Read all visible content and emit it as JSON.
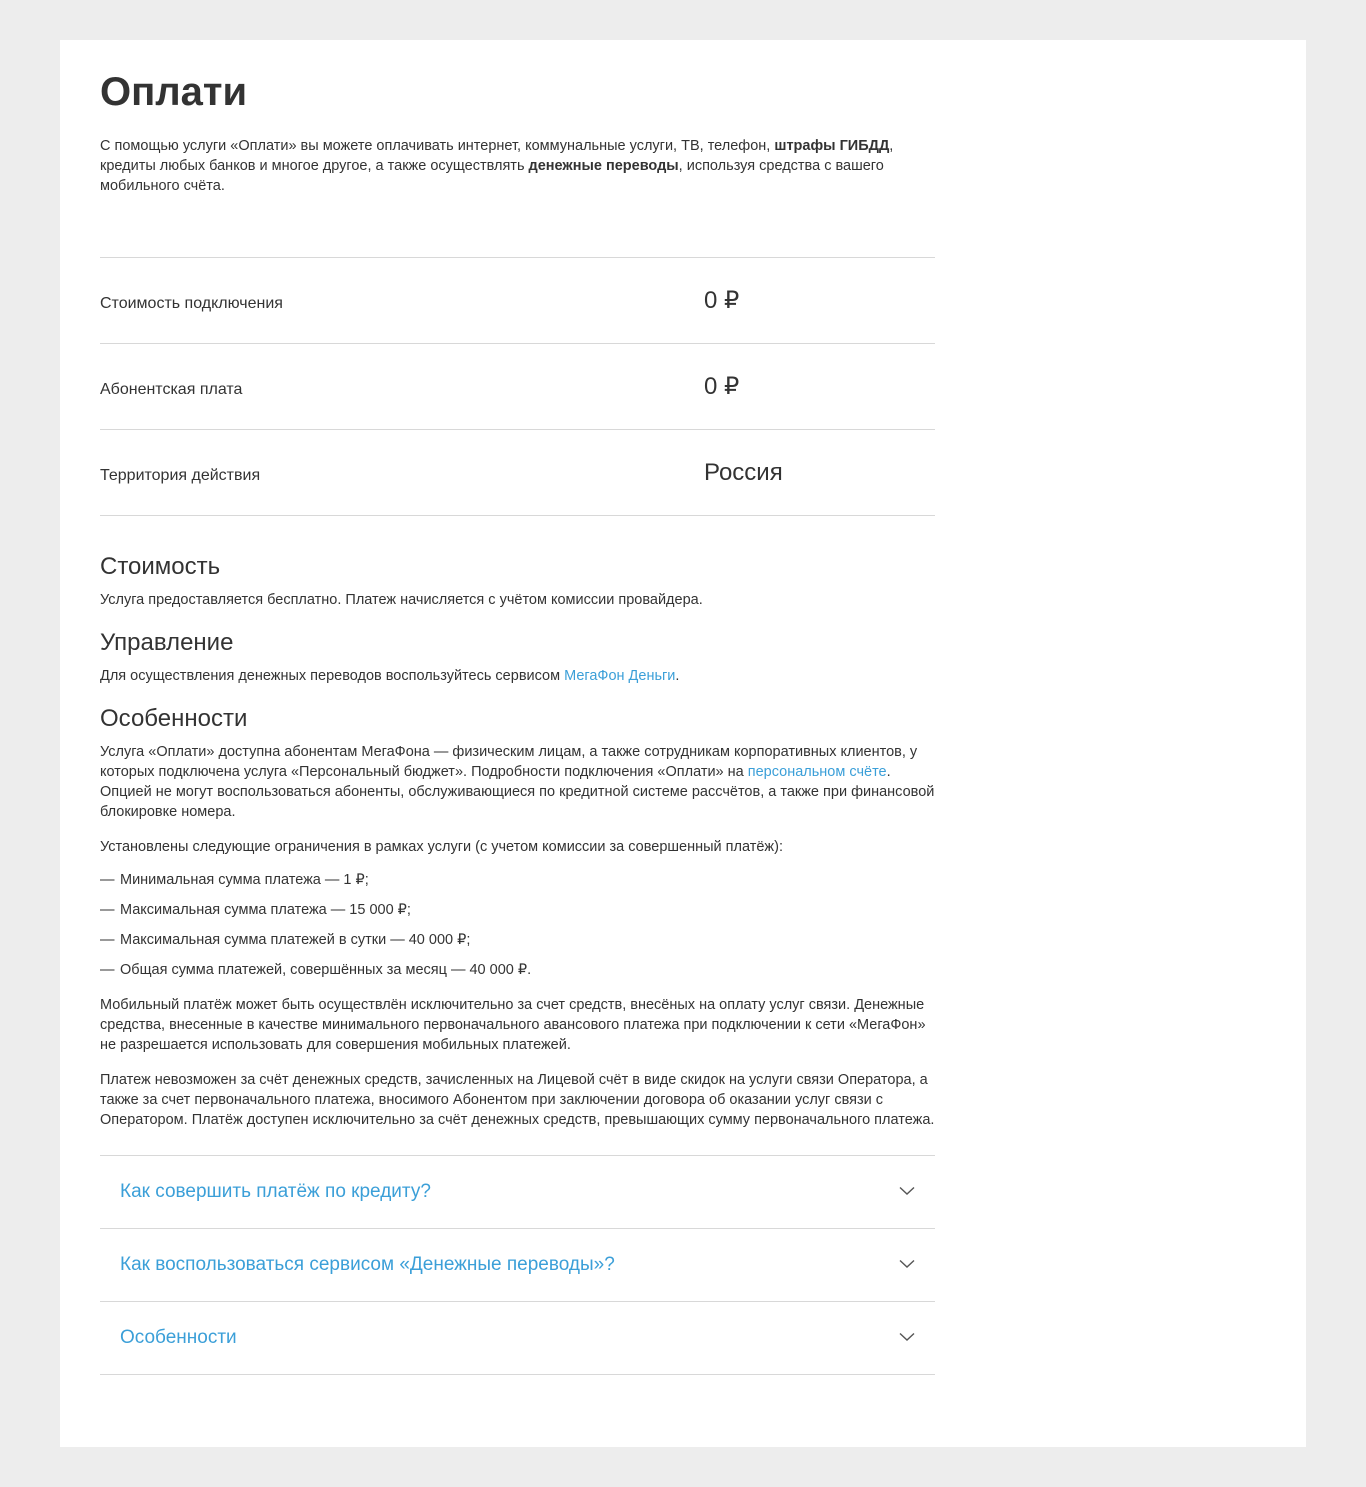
{
  "page": {
    "title": "Оплати",
    "intro": {
      "part1": "С помощью услуги «Оплати» вы можете оплачивать интернет, коммунальные услуги, ТВ, телефон, ",
      "bold1": "штрафы ГИБДД",
      "part2": ", кредиты любых банков и многое другое, а также осуществлять ",
      "bold2": "денежные переводы",
      "part3": ", используя средства с вашего мобильного счёта."
    }
  },
  "params": [
    {
      "label": "Стоимость подключения",
      "value": "0 ₽"
    },
    {
      "label": "Абонентская плата",
      "value": "0 ₽"
    },
    {
      "label": "Территория действия",
      "value": "Россия"
    }
  ],
  "cost": {
    "title": "Стоимость",
    "text": "Услуга предоставляется бесплатно. Платеж начисляется с учётом комиссии провайдера."
  },
  "management": {
    "title": "Управление",
    "text_before": "Для осуществления денежных переводов воспользуйтесь сервисом ",
    "link": "МегаФон Деньги",
    "text_after": "."
  },
  "features": {
    "title": "Особенности",
    "p1_before": "Услуга «Оплати» доступна абонентам МегаФона — физическим лицам, а также сотрудникам корпоративных клиентов, у которых подключена услуга «Персональный бюджет». Подробности подключения «Оплати» на ",
    "p1_link": "персональном счёте",
    "p1_after": ". Опцией не могут воспользоваться абоненты, обслуживающиеся по кредитной системе рассчётов, а также при финансовой блокировке номера.",
    "p2": "Установлены следующие ограничения в рамках услуги (с учетом комиссии за совершенный платёж):",
    "dash": "—",
    "limits": [
      "Минимальная сумма платежа — 1 ₽;",
      "Максимальная сумма платежа — 15 000 ₽;",
      "Максимальная сумма платежей в сутки — 40 000 ₽;",
      "Общая сумма платежей, совершённых за месяц — 40 000 ₽."
    ],
    "p3": "Мобильный платёж может быть осуществлён исключительно за счет средств, внесёных на оплату услуг связи. Денежные средства, внесенные в качестве минимального первоначального авансового платежа при подключении к сети «МегаФон» не разрешается использовать для совершения мобильных платежей.",
    "p4": "Платеж невозможен за счёт денежных средств, зачисленных на Лицевой счёт в виде скидок на услуги связи Оператора, а также за счет первоначального платежа, вносимого Абонентом при заключении договора об оказании услуг связи с Оператором. Платёж доступен исключительно за счёт денежных средств, превышающих сумму первоначального платежа."
  },
  "faq": [
    {
      "title": "Как совершить платёж по кредиту?",
      "icon": "chevron-down-icon"
    },
    {
      "title": "Как воспользоваться сервисом «Денежные переводы»?",
      "icon": "chevron-down-icon"
    },
    {
      "title": "Особенности",
      "icon": "chevron-down-icon"
    }
  ],
  "colors": {
    "link": "#3b9fd8",
    "text": "#333333",
    "background": "#ededed",
    "divider": "#d8d8d8"
  }
}
